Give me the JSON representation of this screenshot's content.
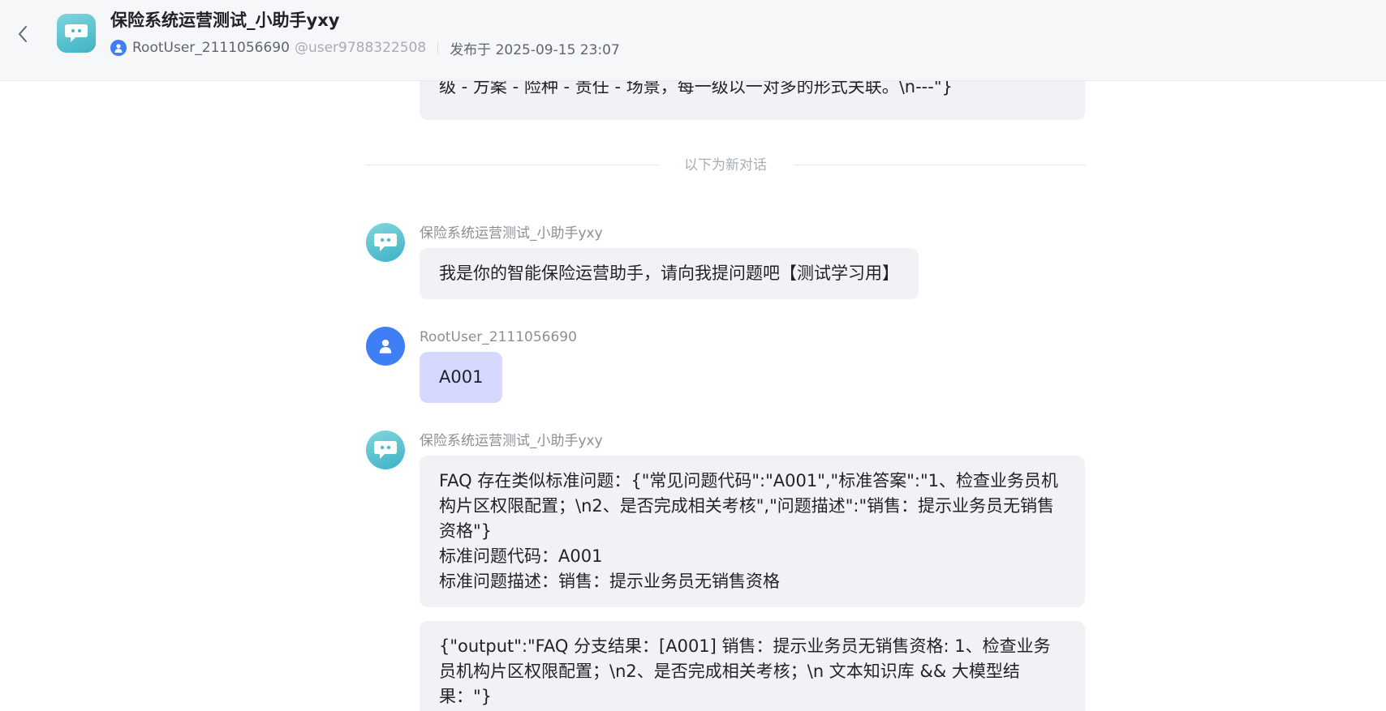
{
  "header": {
    "title": "保险系统运营测试_小助手yxy",
    "author": "RootUser_2111056690",
    "handle": "@user9788322508",
    "published": "发布于 2025-09-15 23:07"
  },
  "conversation": {
    "partial_message": "级 - 方案 - 险种 - 责任 - 场景，每一级以一对多的形式关联。\\n---\"}",
    "divider_text": "以下为新对话",
    "messages": [
      {
        "role": "bot",
        "sender": "保险系统运营测试_小助手yxy",
        "text": "我是你的智能保险运营助手，请向我提问题吧【测试学习用】"
      },
      {
        "role": "user",
        "sender": "RootUser_2111056690",
        "text": "A001"
      },
      {
        "role": "bot",
        "sender": "保险系统运营测试_小助手yxy",
        "bubbles": [
          "FAQ 存在类似标准问题：{\"常见问题代码\":\"A001\",\"标准答案\":\"1、检查业务员机构片区权限配置；\\n2、是否完成相关考核\",\"问题描述\":\"销售：提示业务员无销售资格\"}\n标准问题代码：A001\n标准问题描述：销售：提示业务员无销售资格",
          "{\"output\":\"FAQ 分支结果：[A001] 销售：提示业务员无销售资格: 1、检查业务员机构片区权限配置；\\n2、是否完成相关考核；\\n 文本知识库 && 大模型结果：\"}"
        ]
      }
    ]
  },
  "colors": {
    "header_bg": "#f6f7f9",
    "bot_bubble": "#f1f2f6",
    "user_bubble": "#d6d8fd",
    "user_avatar": "#3f7ff5",
    "bot_avatar": "#4cbccb"
  },
  "icons": {
    "back": "chevron-left-icon",
    "bot": "chat-bubble-icon",
    "user": "person-icon"
  }
}
